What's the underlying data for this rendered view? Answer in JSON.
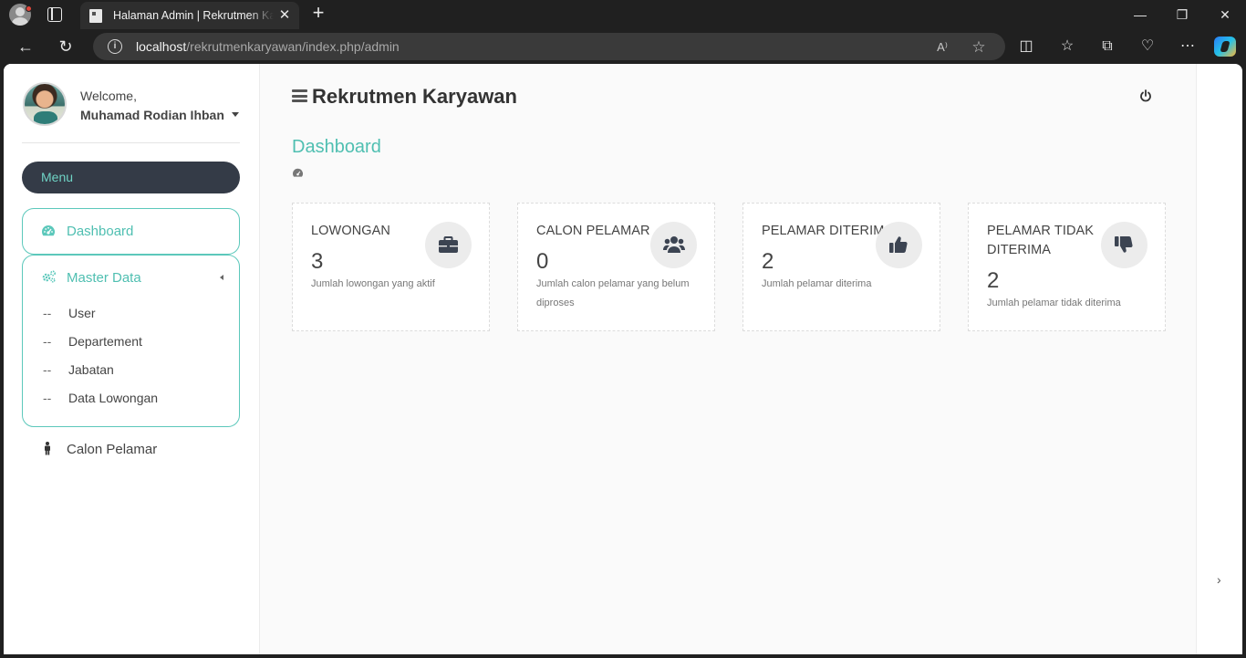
{
  "browser": {
    "tab_title": "Halaman Admin | Rekrutmen Karyawan",
    "tab_close": "✕",
    "new_tab": "+",
    "url_host": "localhost",
    "url_path": "/rekrutmenkaryawan/index.php/admin",
    "window_controls": {
      "minimize": "—",
      "maximize": "❐",
      "close": "✕"
    }
  },
  "sidebar": {
    "welcome": "Welcome,",
    "username": "Muhamad Rodian Ihban",
    "menu_header": "Menu",
    "dashboard_label": "Dashboard",
    "master_label": "Master Data",
    "master_items": [
      "User",
      "Departement",
      "Jabatan",
      "Data Lowongan"
    ],
    "sub_prefix": "--",
    "calon_label": "Calon Pelamar"
  },
  "header": {
    "app_title": "Rekrutmen Karyawan",
    "page_title": "Dashboard"
  },
  "cards": [
    {
      "label": "LOWONGAN",
      "value": "3",
      "desc": "Jumlah lowongan yang aktif",
      "icon": "briefcase-icon"
    },
    {
      "label": "CALON PELAMAR",
      "value": "0",
      "desc": "Jumlah calon pelamar yang belum diproses",
      "icon": "users-icon"
    },
    {
      "label": "PELAMAR DITERIMA",
      "value": "2",
      "desc": "Jumlah pelamar diterima",
      "icon": "thumbs-up-icon"
    },
    {
      "label": "PELAMAR TIDAK DITERIMA",
      "value": "2",
      "desc": "Jumlah pelamar tidak diterima",
      "icon": "thumbs-down-icon"
    }
  ],
  "colors": {
    "accent": "#4fbfb1",
    "menu_bg": "#343b47",
    "chrome_bg": "#202020"
  }
}
